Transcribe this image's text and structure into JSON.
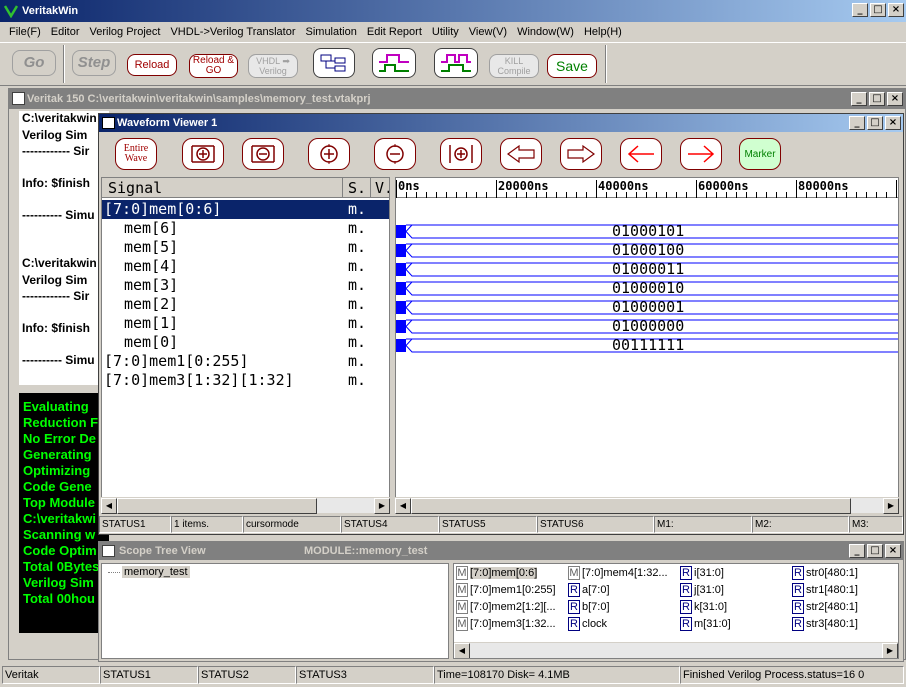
{
  "app": {
    "title": "VeritakWin"
  },
  "menu": [
    "File(F)",
    "Editor",
    "Verilog Project",
    "VHDL->Verilog Translator",
    "Simulation",
    "Edit Report",
    "Utility",
    "View(V)",
    "Window(W)",
    "Help(H)"
  ],
  "toolbar": {
    "go": "Go",
    "step": "Step",
    "reload": "Reload",
    "reload_go": "Reload & GO",
    "vhdl_verilog": "VHDL ➡ Verilog",
    "kill_compile": "KILL Compile",
    "save": "Save"
  },
  "project": {
    "title": "Veritak 150 C:\\veritakwin\\veritakwin\\samples\\memory_test.vtakprj",
    "log_lines": [
      "C:\\veritakwin",
      "Verilog Sim",
      "------------ Sir",
      "Info: $finish",
      "---------- Simu",
      "C:\\veritakwin",
      "Verilog Sim",
      "------------ Sir",
      "Info: $finish",
      "---------- Simu"
    ],
    "console_lines": [
      "Evaluating",
      "Reduction F",
      "No Error De",
      "Generating",
      "Optimizing",
      "Code Gene",
      "Top Module",
      "C:\\veritakwi",
      "Scanning w",
      "Code Optim",
      "Total 0Bytes",
      "Verilog Sim",
      "Total 00hou"
    ]
  },
  "waveform": {
    "title": "Waveform Viewer 1",
    "entire_wave": "Entire Wave",
    "marker": "Marker",
    "header": {
      "signal": "Signal",
      "s": "S.",
      "v": "V."
    },
    "signals": [
      {
        "name": "[7:0]mem[0:6]",
        "s": "m.",
        "indent": false,
        "selected": true
      },
      {
        "name": "mem[6]",
        "s": "m.",
        "indent": true
      },
      {
        "name": "mem[5]",
        "s": "m.",
        "indent": true
      },
      {
        "name": "mem[4]",
        "s": "m.",
        "indent": true
      },
      {
        "name": "mem[3]",
        "s": "m.",
        "indent": true
      },
      {
        "name": "mem[2]",
        "s": "m.",
        "indent": true
      },
      {
        "name": "mem[1]",
        "s": "m.",
        "indent": true
      },
      {
        "name": "mem[0]",
        "s": "m.",
        "indent": true
      },
      {
        "name": "[7:0]mem1[0:255]",
        "s": "m.",
        "indent": false
      },
      {
        "name": "[7:0]mem3[1:32][1:32]",
        "s": "m.",
        "indent": false
      }
    ],
    "ruler": [
      "0ns",
      "20000ns",
      "40000ns",
      "60000ns",
      "80000ns"
    ],
    "values": [
      "01000101",
      "01000100",
      "01000011",
      "01000010",
      "01000001",
      "01000000",
      "00111111"
    ],
    "status": [
      "STATUS1",
      "1 items.",
      "cursormode",
      "STATUS4",
      "STATUS5",
      "STATUS6",
      "M1:",
      "M2:",
      "M3:"
    ]
  },
  "scope": {
    "title": "Scope Tree View",
    "module": "MODULE::memory_test",
    "tree_node": "memory_test",
    "vars": [
      {
        "badge": "M",
        "label": "[7:0]mem[0:6]",
        "selected": true
      },
      {
        "badge": "M",
        "label": "[7:0]mem1[0:255]"
      },
      {
        "badge": "M",
        "label": "[7:0]mem2[1:2][..."
      },
      {
        "badge": "M",
        "label": "[7:0]mem3[1:32..."
      },
      {
        "badge": "M",
        "label": "[7:0]mem4[1:32..."
      },
      {
        "badge": "R",
        "label": "a[7:0]"
      },
      {
        "badge": "R",
        "label": "b[7:0]"
      },
      {
        "badge": "R",
        "label": "clock"
      },
      {
        "badge": "R",
        "label": "i[31:0]"
      },
      {
        "badge": "R",
        "label": "j[31:0]"
      },
      {
        "badge": "R",
        "label": "k[31:0]"
      },
      {
        "badge": "R",
        "label": "m[31:0]"
      },
      {
        "badge": "R",
        "label": "str0[480:1]"
      },
      {
        "badge": "R",
        "label": "str1[480:1]"
      },
      {
        "badge": "R",
        "label": "str2[480:1]"
      },
      {
        "badge": "R",
        "label": "str3[480:1]"
      }
    ]
  },
  "statusbar": [
    "Veritak",
    "STATUS1",
    "STATUS2",
    "STATUS3",
    "Time=108170 Disk=  4.1MB",
    "Finished Verilog Process.status=16 0"
  ],
  "colors": {
    "title_active": "#0a246a",
    "bus_blue": "#0000ff",
    "console_green": "#00ff00",
    "accent_red": "#a00000"
  }
}
